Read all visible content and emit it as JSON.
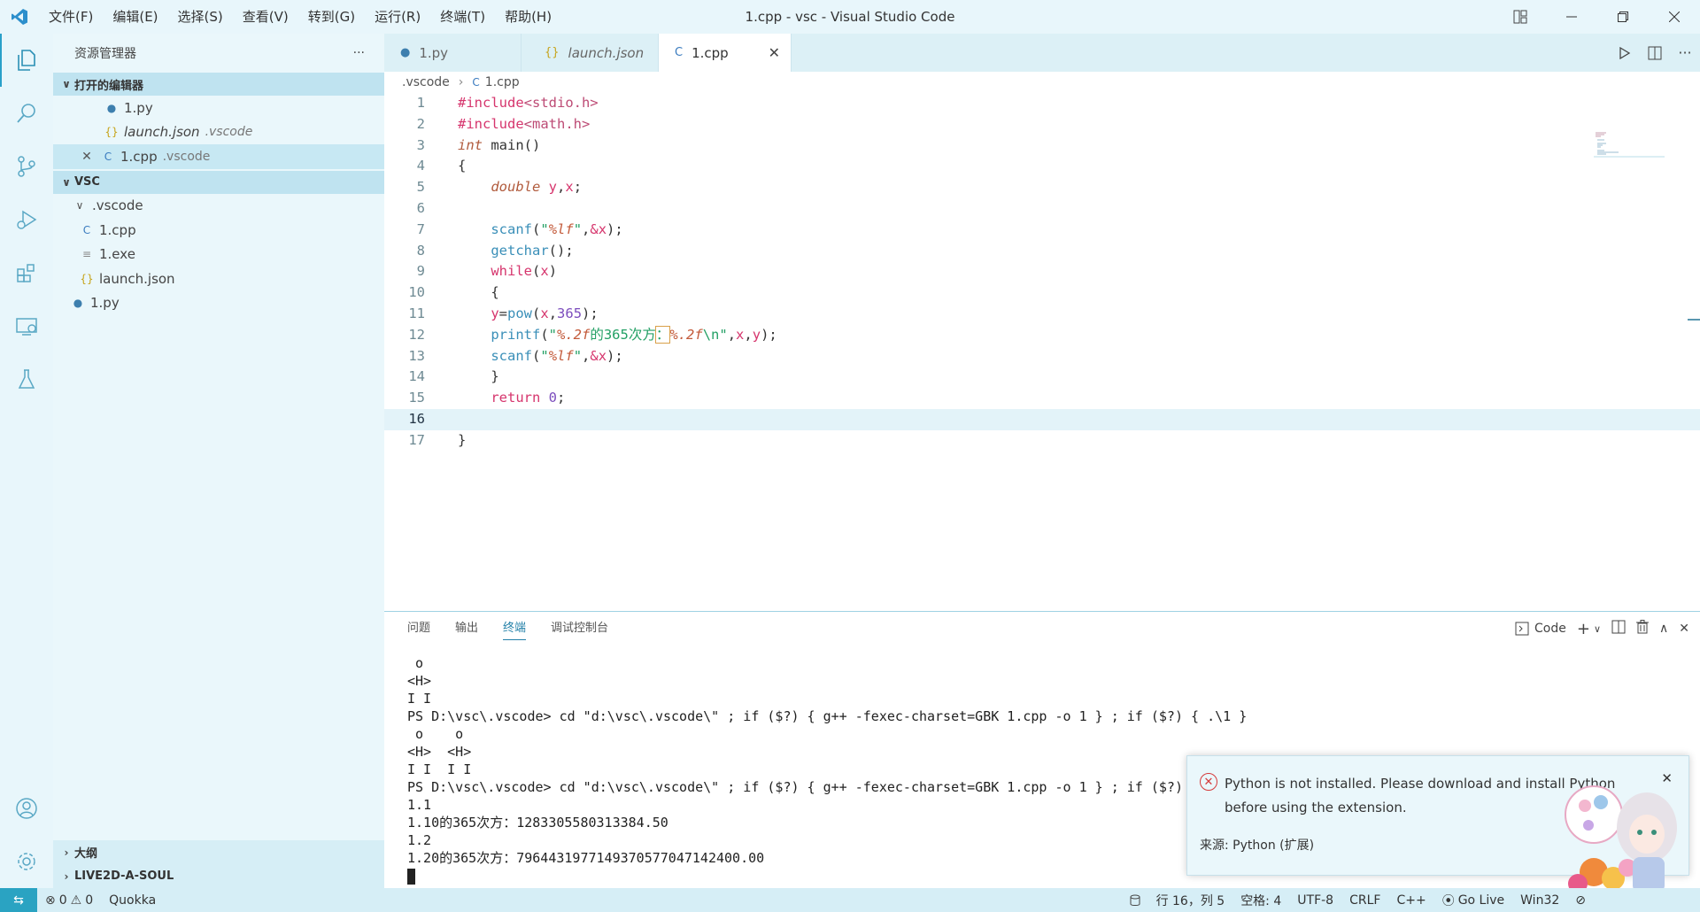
{
  "window": {
    "title": "1.cpp - vsc - Visual Studio Code",
    "menu": [
      "文件(F)",
      "编辑(E)",
      "选择(S)",
      "查看(V)",
      "转到(G)",
      "运行(R)",
      "终端(T)",
      "帮助(H)"
    ]
  },
  "sidebar": {
    "title": "资源管理器",
    "open_editors": {
      "label": "打开的编辑器",
      "items": [
        {
          "name": "1.py",
          "desc": ""
        },
        {
          "name": "launch.json",
          "desc": ".vscode"
        },
        {
          "name": "1.cpp",
          "desc": ".vscode"
        }
      ]
    },
    "workspace": {
      "label": "VSC",
      "folder": ".vscode",
      "files": [
        "1.cpp",
        "1.exe",
        "launch.json"
      ],
      "root_file": "1.py"
    },
    "outline_label": "大纲",
    "live2d_label": "LIVE2D-A-SOUL"
  },
  "tabs": [
    {
      "label": "1.py",
      "active": false
    },
    {
      "label": "launch.json",
      "active": false
    },
    {
      "label": "1.cpp",
      "active": true
    }
  ],
  "breadcrumb": {
    "folder": ".vscode",
    "file": "1.cpp"
  },
  "code": {
    "line_numbers": [
      "1",
      "2",
      "3",
      "4",
      "5",
      "6",
      "7",
      "8",
      "9",
      "10",
      "11",
      "12",
      "13",
      "14",
      "15",
      "16",
      "17"
    ],
    "lines": [
      "#include<stdio.h>",
      "#include<math.h>",
      "int main()",
      "{",
      "    double y,x;",
      "",
      "    scanf(\"%lf\",&x);",
      "    getchar();",
      "    while(x)",
      "    {",
      "    y=pow(x,365);",
      "    printf(\"%.2f的365次方：%.2f\\n\",x,y);",
      "    scanf(\"%lf\",&x);",
      "    }",
      "    return 0;",
      "",
      "}"
    ],
    "current_line": 16
  },
  "panel": {
    "tabs": [
      "问题",
      "输出",
      "终端",
      "调试控制台"
    ],
    "active_tab": "终端",
    "terminal_name": "Code",
    "terminal_lines": [
      " o",
      "<H>",
      "I I",
      "PS D:\\vsc\\.vscode> cd \"d:\\vsc\\.vscode\\\" ; if ($?) { g++ -fexec-charset=GBK 1.cpp -o 1 } ; if ($?) { .\\1 }",
      " o    o",
      "<H>  <H>",
      "I I  I I",
      "PS D:\\vsc\\.vscode> cd \"d:\\vsc\\.vscode\\\" ; if ($?) { g++ -fexec-charset=GBK 1.cpp -o 1 } ; if ($?)",
      "1.1",
      "1.10的365次方：1283305580313384.50",
      "1.2",
      "1.20的365次方：7964431977149370577047142400.00"
    ]
  },
  "notification": {
    "message": "Python is not installed. Please download and install Python before using the extension.",
    "source": "来源: Python (扩展)"
  },
  "statusbar": {
    "errors": "0",
    "warnings": "0",
    "quokka": "Quokka",
    "position": "行 16，列 5",
    "spaces": "空格: 4",
    "encoding": "UTF-8",
    "eol": "CRLF",
    "language": "C++",
    "golive": "Go Live",
    "platform": "Win32"
  },
  "colors": {
    "accent": "#29a0c9",
    "error": "#d53b3b",
    "status_remote": "#2aa3c2"
  }
}
